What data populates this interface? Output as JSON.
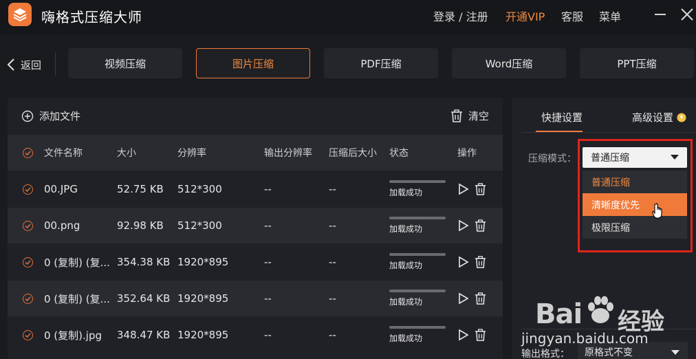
{
  "app": {
    "title": "嗨格式压缩大师",
    "brand_color": "#f07a3a",
    "login_register": "登录 / 注册",
    "vip": "开通VIP",
    "service": "客服",
    "menu": "菜单"
  },
  "nav": {
    "back": "返回",
    "tabs": [
      "视频压缩",
      "图片压缩",
      "PDF压缩",
      "Word压缩",
      "PPT压缩"
    ],
    "active_tab": "图片压缩"
  },
  "file_panel": {
    "add_file": "添加文件",
    "clear": "清空",
    "columns": [
      "文件名称",
      "大小",
      "分辨率",
      "输出分辨率",
      "压缩后大小",
      "状态",
      "操作"
    ],
    "rows": [
      {
        "name": "00.JPG",
        "size": "52.75 KB",
        "resolution": "512*300",
        "out_resolution": "--",
        "out_size": "--",
        "status": "加载成功",
        "progress": 1
      },
      {
        "name": "00.png",
        "size": "92.98 KB",
        "resolution": "512*300",
        "out_resolution": "--",
        "out_size": "--",
        "status": "加载成功",
        "progress": 1
      },
      {
        "name": "0 (复制) (复...",
        "size": "354.38 KB",
        "resolution": "1920*895",
        "out_resolution": "--",
        "out_size": "--",
        "status": "加载成功",
        "progress": 1
      },
      {
        "name": "0 (复制) (复...",
        "size": "352.64 KB",
        "resolution": "1920*895",
        "out_resolution": "--",
        "out_size": "--",
        "status": "加载成功",
        "progress": 1
      },
      {
        "name": "0 (复制).jpg",
        "size": "348.47 KB",
        "resolution": "1920*895",
        "out_resolution": "--",
        "out_size": "--",
        "status": "加载成功",
        "progress": 1
      }
    ]
  },
  "settings": {
    "tab_quick": "快捷设置",
    "tab_advanced": "高级设置",
    "mode_label": "压缩模式：",
    "mode_value": "普通压缩",
    "mode_options": [
      "普通压缩",
      "清晰度优先",
      "极限压缩"
    ],
    "hovered_option": "清晰度优先",
    "output_label": "输出格式：",
    "output_value": "原格式不变"
  },
  "watermark": {
    "brand": "Bai",
    "text": "经验",
    "url": "jingyan.baidu.com"
  }
}
